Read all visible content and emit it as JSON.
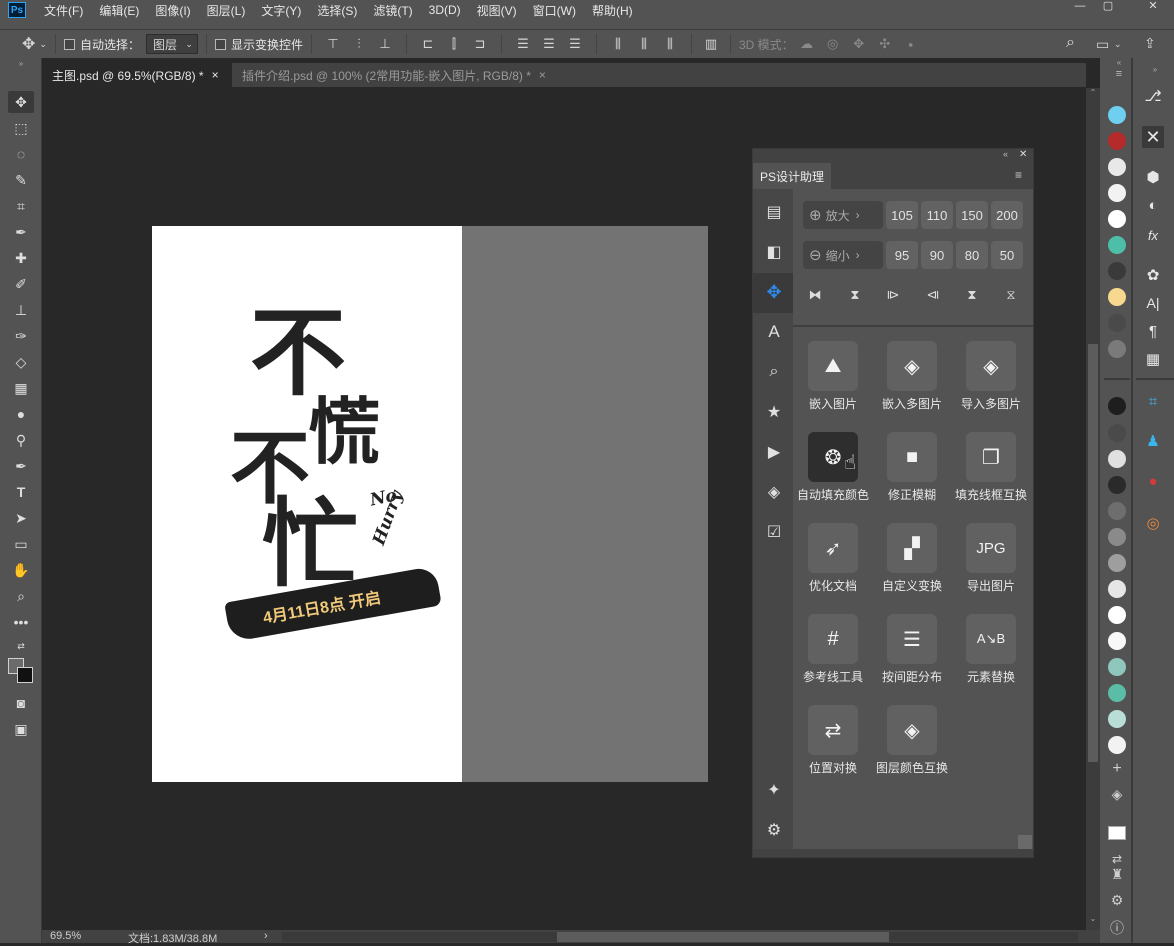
{
  "app": {
    "logo": "Ps"
  },
  "menu": [
    "文件(F)",
    "编辑(E)",
    "图像(I)",
    "图层(L)",
    "文字(Y)",
    "选择(S)",
    "滤镜(T)",
    "3D(D)",
    "视图(V)",
    "窗口(W)",
    "帮助(H)"
  ],
  "window_controls": [
    "—",
    "▢",
    "✕"
  ],
  "options": {
    "auto_select_label": "自动选择：",
    "auto_select_value": "图层",
    "show_transform_label": "显示变换控件",
    "mode_3d_label": "3D 模式："
  },
  "tabs": [
    {
      "label": "主图.psd @ 69.5%(RGB/8) *",
      "close": "×"
    },
    {
      "label": "插件介绍.psd @ 100% (2常用功能-嵌入图片, RGB/8) *",
      "close": "×"
    }
  ],
  "artwork": {
    "title_lines": [
      "不",
      "慌",
      "不",
      "忙"
    ],
    "english": [
      "No",
      "Hurry"
    ],
    "banner": "4月11日8点 开启"
  },
  "status": {
    "zoom": "69.5%",
    "doc": "文档:1.83M/38.8M",
    "arrow": "›"
  },
  "panel": {
    "title": "PS设计助理",
    "zoom_in_label": "放大",
    "zoom_out_label": "缩小",
    "zoom_in_values": [
      "105",
      "110",
      "150",
      "200"
    ],
    "zoom_out_values": [
      "95",
      "90",
      "80",
      "50"
    ],
    "features": [
      {
        "label": "嵌入图片",
        "icon": "mountain-icon"
      },
      {
        "label": "嵌入多图片",
        "icon": "layers-icon"
      },
      {
        "label": "导入多图片",
        "icon": "import-layers-icon"
      },
      {
        "label": "自动填充颜色",
        "icon": "color-circles-icon"
      },
      {
        "label": "修正模糊",
        "icon": "square-icon"
      },
      {
        "label": "填充线框互换",
        "icon": "double-square-icon"
      },
      {
        "label": "优化文档",
        "icon": "rocket-icon"
      },
      {
        "label": "自定义变换",
        "icon": "steps-icon"
      },
      {
        "label": "导出图片",
        "icon": "jpg-icon",
        "text": "JPG"
      },
      {
        "label": "参考线工具",
        "icon": "grid-icon"
      },
      {
        "label": "按间距分布",
        "icon": "distribute-icon"
      },
      {
        "label": "元素替换",
        "icon": "ab-swap-icon"
      },
      {
        "label": "位置对换",
        "icon": "swap-position-icon"
      },
      {
        "label": "图层颜色互换",
        "icon": "layer-swap-icon"
      }
    ]
  },
  "colors": {
    "swatches": [
      "#6ecff0",
      "#b52b2b",
      "#e8e8e8",
      "#f2f2f2",
      "#ffffff",
      "#4dbfa8",
      "#3a3a3a",
      "#f6d98e",
      "#4a4a4a",
      "#7a7a7a"
    ],
    "swatches2": [
      "#1e1e1e",
      "#4a4a4a",
      "#e0e0e0",
      "#2a2a2a",
      "#6e6e6e",
      "#8a8a8a",
      "#9e9e9e",
      "#e6e6e6",
      "#ffffff",
      "#f8f8f8",
      "#8fc7bd",
      "#5bbda6",
      "#b9ded8",
      "#f2f2f2"
    ]
  }
}
